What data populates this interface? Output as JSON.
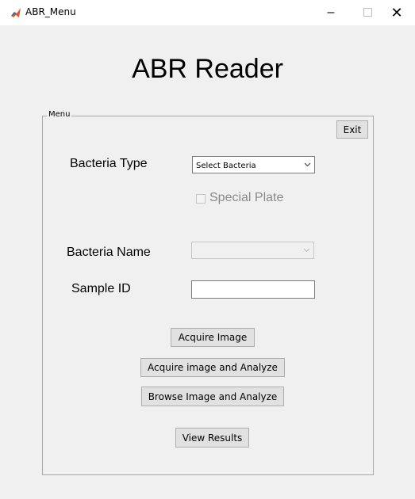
{
  "window": {
    "title": "ABR_Menu",
    "icon": "matlab-icon",
    "minimize_glyph": "–",
    "close_glyph": "✕"
  },
  "app": {
    "title": "ABR Reader"
  },
  "menu_panel": {
    "legend": "Menu",
    "exit_label": "Exit",
    "bacteria_type_label": "Bacteria Type",
    "bacteria_type_select": "Select Bacteria",
    "special_plate_label": "Special Plate",
    "special_plate_checked": false,
    "bacteria_name_label": "Bacteria Name",
    "bacteria_name_select": "",
    "sample_id_label": "Sample ID",
    "sample_id_value": "",
    "buttons": {
      "acquire_image": "Acquire Image",
      "acquire_analyze": "Acquire image and Analyze",
      "browse_analyze": "Browse Image and Analyze",
      "view_results": "View Results"
    }
  }
}
